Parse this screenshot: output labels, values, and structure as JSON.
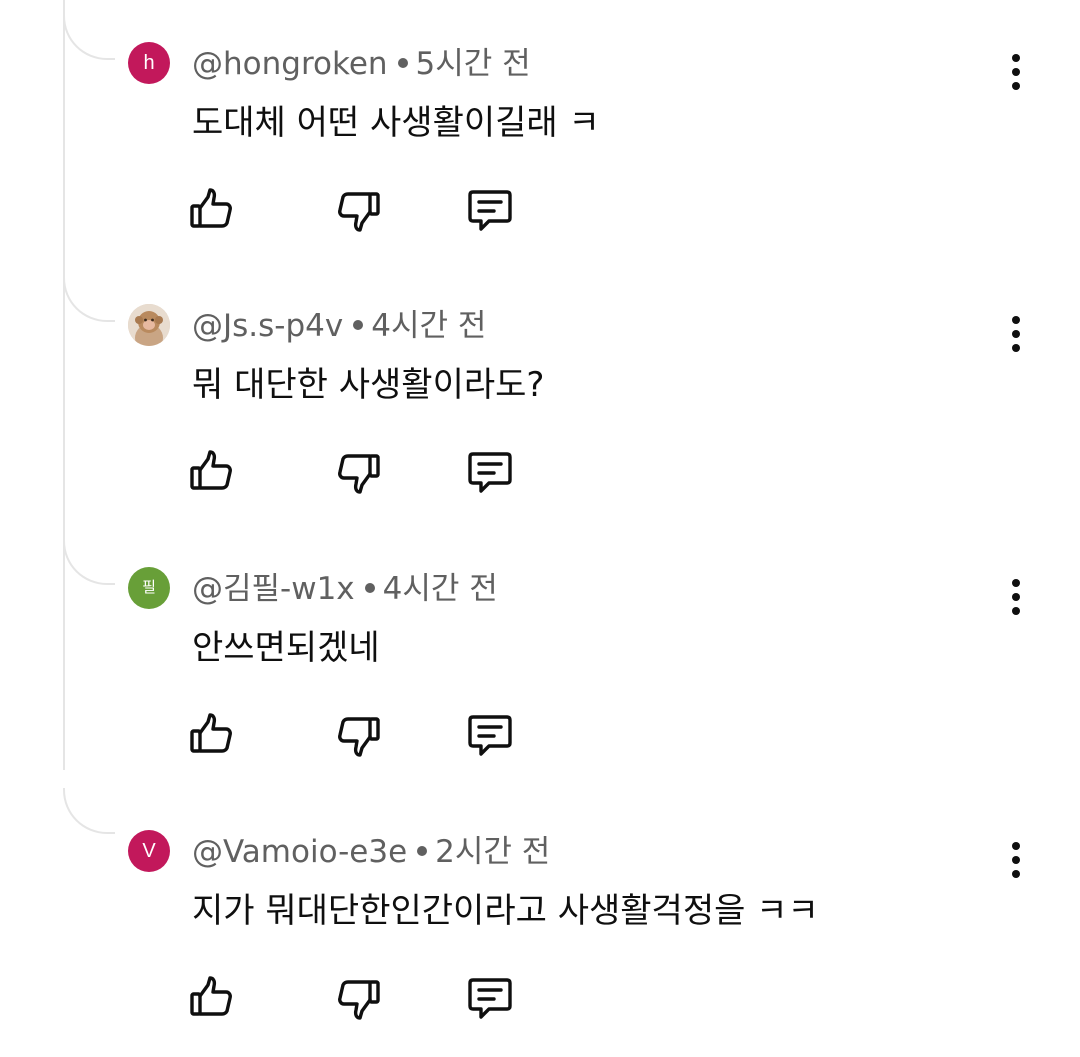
{
  "comments": [
    {
      "handle": "@hongroken",
      "time": "5시간 전",
      "text": "도대체 어떤 사생활이길래 ㅋ",
      "avatar": {
        "type": "letter",
        "letter": "h",
        "color": "#c2185b"
      }
    },
    {
      "handle": "@Js.s-p4v",
      "time": "4시간 전",
      "text": "뭐 대단한 사생활이라도?",
      "avatar": {
        "type": "photo",
        "subject": "monkey"
      }
    },
    {
      "handle": "@김필-w1x",
      "time": "4시간 전",
      "text": "안쓰면되겠네",
      "avatar": {
        "type": "letter",
        "letter": "필",
        "color": "#689f38"
      }
    },
    {
      "handle": "@Vamoio-e3e",
      "time": "2시간 전",
      "text": "지가 뭐대단한인간이라고 사생활걱정을 ㅋㅋ",
      "avatar": {
        "type": "letter",
        "letter": "V",
        "color": "#c2185b"
      }
    }
  ],
  "icons": {
    "like": "thumbs-up-icon",
    "dislike": "thumbs-down-icon",
    "reply": "reply-icon",
    "more": "more-vert-icon"
  },
  "colors": {
    "text_primary": "#0f0f0f",
    "text_secondary": "#606060",
    "thread_line": "#e5e5e5"
  }
}
